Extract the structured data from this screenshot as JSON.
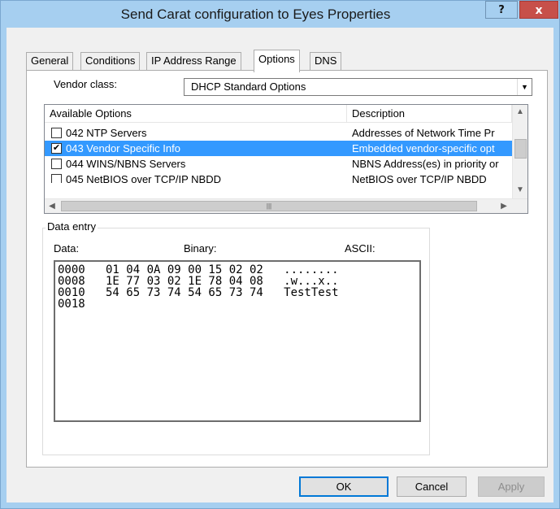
{
  "window": {
    "title": "Send Carat configuration to Eyes Properties",
    "help_label": "?",
    "close_label": "x"
  },
  "tabs": [
    {
      "label": "General"
    },
    {
      "label": "Conditions"
    },
    {
      "label": "IP Address Range"
    },
    {
      "label": "Options",
      "active": true
    },
    {
      "label": "DNS"
    }
  ],
  "vendor_class": {
    "label": "Vendor class:",
    "value": "DHCP Standard Options"
  },
  "options_list": {
    "columns": [
      "Available Options",
      "Description"
    ],
    "rows": [
      {
        "checked": false,
        "option": "042 NTP Servers",
        "description": "Addresses of Network Time Pr"
      },
      {
        "checked": true,
        "option": "043 Vendor Specific Info",
        "description": "Embedded vendor-specific opt",
        "selected": true
      },
      {
        "checked": false,
        "option": "044 WINS/NBNS Servers",
        "description": "NBNS Address(es) in priority or"
      },
      {
        "checked": false,
        "option": "045 NetBIOS over TCP/IP NBDD",
        "description": "NetBIOS over TCP/IP NBDD"
      }
    ]
  },
  "data_entry": {
    "legend": "Data entry",
    "data_label": "Data:",
    "binary_label": "Binary:",
    "ascii_label": "ASCII:",
    "lines": [
      "0000   01 04 0A 09 00 15 02 02   ........",
      "0008   1E 77 03 02 1E 78 04 08   .w...x..",
      "0010   54 65 73 74 54 65 73 74   TestTest",
      "0018"
    ]
  },
  "buttons": {
    "ok": "OK",
    "cancel": "Cancel",
    "apply": "Apply"
  }
}
